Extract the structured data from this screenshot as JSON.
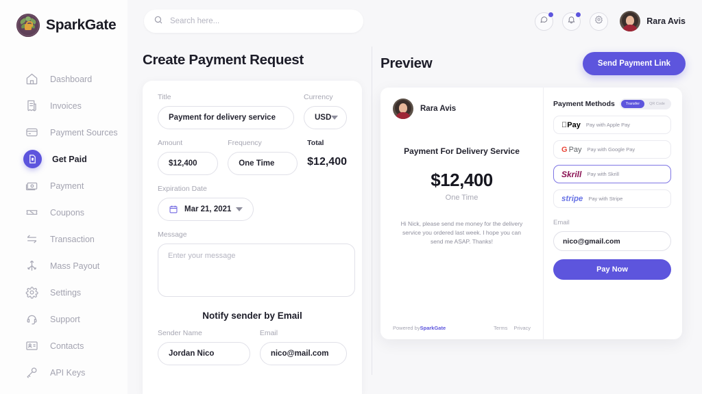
{
  "brand": {
    "name": "SparkGate",
    "logo_icon": "sparkgate-leaf-lock-logo"
  },
  "accent_color": "#5d55dd",
  "sidebar": {
    "items": [
      {
        "label": "Dashboard",
        "icon": "home-icon",
        "active": false
      },
      {
        "label": "Invoices",
        "icon": "invoice-icon",
        "active": false
      },
      {
        "label": "Payment Sources",
        "icon": "credit-card-icon",
        "active": false
      },
      {
        "label": "Get Paid",
        "icon": "document-dollar-icon",
        "active": true
      },
      {
        "label": "Payment",
        "icon": "banknote-icon",
        "active": false
      },
      {
        "label": "Coupons",
        "icon": "coupon-percent-icon",
        "active": false
      },
      {
        "label": "Transaction",
        "icon": "transfer-arrows-icon",
        "active": false
      },
      {
        "label": "Mass Payout",
        "icon": "mass-payout-icon",
        "active": false
      },
      {
        "label": "Settings",
        "icon": "gear-icon",
        "active": false
      },
      {
        "label": "Support",
        "icon": "support-headset-icon",
        "active": false
      },
      {
        "label": "Contacts",
        "icon": "contact-card-icon",
        "active": false
      },
      {
        "label": "API  Keys",
        "icon": "key-icon",
        "active": false
      }
    ]
  },
  "topbar": {
    "search_placeholder": "Search here...",
    "search_value": "",
    "search_icon": "search-icon",
    "chat_icon": "chat-bubble-icon",
    "bell_icon": "bell-icon",
    "gear_icon": "gear-icon",
    "user_name": "Rara Avis",
    "avatar_icon": "user-avatar"
  },
  "form": {
    "title": "Create Payment Request",
    "fields": {
      "title_label": "Title",
      "title_value": "Payment for delivery service",
      "currency_label": "Currency",
      "currency_value": "USD",
      "amount_label": "Amount",
      "amount_value": "$12,400",
      "frequency_label": "Frequency",
      "frequency_value": "One Time",
      "total_label": "Total",
      "total_value": "$12,400",
      "expiration_label": "Expiration Date",
      "expiration_value": "Mar 21, 2021",
      "calendar_icon": "calendar-icon",
      "message_label": "Message",
      "message_placeholder": "Enter your message",
      "message_value": ""
    },
    "notify": {
      "heading": "Notify sender by Email",
      "sender_name_label": "Sender Name",
      "sender_name_value": "Jordan Nico",
      "email_label": "Email",
      "email_value": "nico@mail.com"
    }
  },
  "preview": {
    "title": "Preview",
    "send_button": "Send Payment Link",
    "card": {
      "user_name": "Rara Avis",
      "payment_title": "Payment For Delivery Service",
      "amount": "$12,400",
      "frequency": "One Time",
      "message": "Hi Nick, please send me money for the delivery service you ordered last week. I hope you can send me ASAP. Thanks!",
      "powered_by_prefix": "Powered by ",
      "powered_by_brand": "SparkGate",
      "terms_link": "Terms",
      "privacy_link": "Privacy"
    },
    "methods_panel": {
      "title": "Payment Methods",
      "toggle": [
        {
          "label": "Transfer",
          "active": true
        },
        {
          "label": "QR Code",
          "active": false
        }
      ],
      "methods": [
        {
          "brand": "Pay",
          "brand_icon": "apple-pay-logo",
          "label": "Pay with Apple Pay",
          "selected": false
        },
        {
          "brand": "Pay",
          "brand_icon": "google-pay-logo",
          "label": "Pay with Google Pay",
          "selected": false
        },
        {
          "brand": "Skrill",
          "brand_icon": "skrill-logo",
          "label": "Pay with Skrill",
          "selected": true
        },
        {
          "brand": "stripe",
          "brand_icon": "stripe-logo",
          "label": "Pay with Stripe",
          "selected": false
        }
      ],
      "email_label": "Email",
      "email_value": "nico@gmail.com",
      "pay_button": "Pay Now"
    }
  }
}
